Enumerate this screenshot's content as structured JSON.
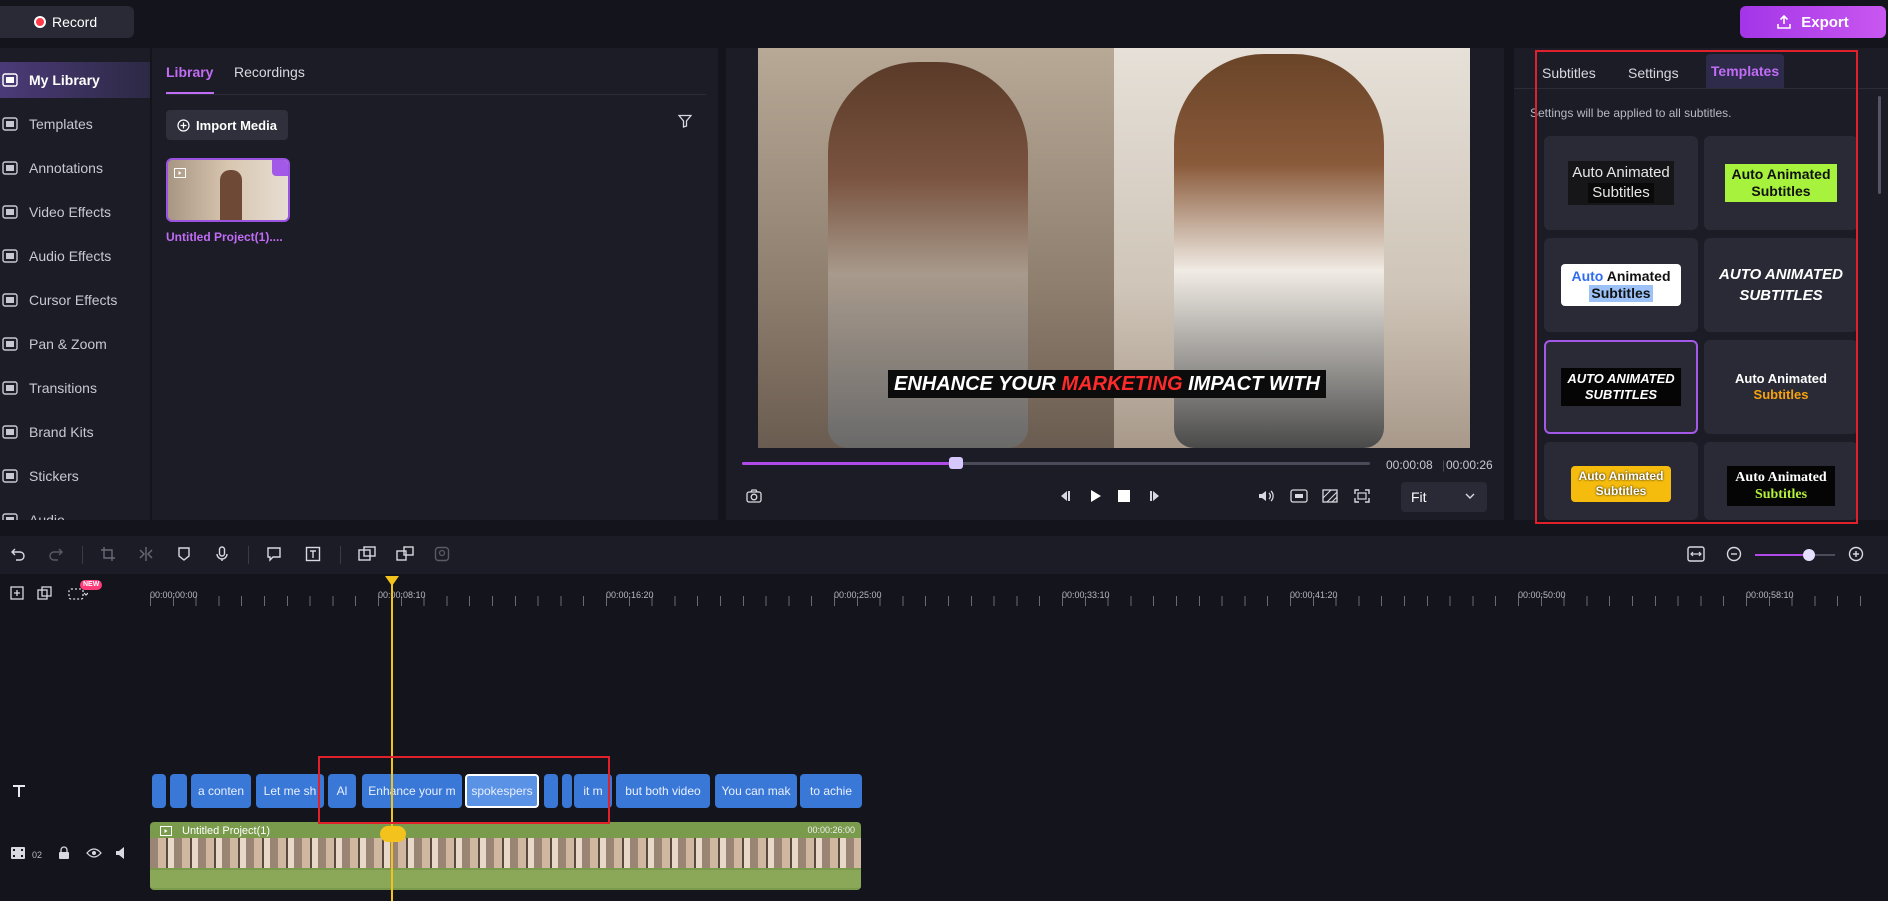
{
  "topbar": {
    "record_label": "Record",
    "export_label": "Export"
  },
  "sidebar": {
    "items": [
      {
        "label": "My Library",
        "icon": "library-icon",
        "active": true
      },
      {
        "label": "Templates",
        "icon": "templates-icon"
      },
      {
        "label": "Annotations",
        "icon": "annotations-icon"
      },
      {
        "label": "Video Effects",
        "icon": "video-effects-icon"
      },
      {
        "label": "Audio Effects",
        "icon": "audio-effects-icon"
      },
      {
        "label": "Cursor Effects",
        "icon": "cursor-effects-icon"
      },
      {
        "label": "Pan & Zoom",
        "icon": "pan-zoom-icon"
      },
      {
        "label": "Transitions",
        "icon": "transitions-icon"
      },
      {
        "label": "Brand Kits",
        "icon": "brand-kits-icon"
      },
      {
        "label": "Stickers",
        "icon": "stickers-icon"
      },
      {
        "label": "Audio",
        "icon": "audio-icon"
      }
    ]
  },
  "library": {
    "tabs": [
      "Library",
      "Recordings"
    ],
    "import_label": "Import Media",
    "media": [
      {
        "label": "Untitled Project(1)...."
      }
    ]
  },
  "preview": {
    "caption": {
      "before": "ENHANCE YOUR ",
      "highlight": "MARKETING",
      "after": " IMPACT WITH"
    },
    "progress": 0.34,
    "current_time": "00:00:08",
    "total_time": "00:00:26",
    "fit_label": "Fit"
  },
  "right_panel": {
    "tabs": [
      "Subtitles",
      "Settings",
      "Templates"
    ],
    "active_tab": "Templates",
    "note": "Settings will be applied to all subtitles.",
    "templates": [
      {
        "line1": "Auto Animated",
        "line2": "Subtitles"
      },
      {
        "line1": "Auto Animated",
        "line2": "Subtitles"
      },
      {
        "line1a": "Auto",
        "line1b": " Animated",
        "line2": "Subtitles"
      },
      {
        "line1": "AUTO ANIMATED",
        "line2": "SUBTITLES"
      },
      {
        "line1": "AUTO ANIMATED",
        "line2": "SUBTITLES"
      },
      {
        "line1": "Auto Animated",
        "line2": "Subtitles"
      },
      {
        "line1": "Auto Animated",
        "line2": "Subtitles"
      },
      {
        "line1": "Auto Animated",
        "line2": "Subtitles"
      }
    ]
  },
  "timeline": {
    "ruler": [
      "00:00:00:00",
      "00:00:08:10",
      "00:00:16:20",
      "00:00:25:00",
      "00:00:33:10",
      "00:00:41:20",
      "00:00:50:00",
      "00:00:58:10"
    ],
    "new_badge": "NEW",
    "subtitles": [
      "",
      "",
      "a conten",
      "Let me sh",
      "Al",
      "Enhance your m",
      "spokespers",
      "",
      "",
      "it m",
      "but both video",
      "You can mak",
      "to achie"
    ],
    "clip": {
      "name": "Untitled Project(1)",
      "duration": "00:00:26:00"
    },
    "track_number": "02"
  }
}
